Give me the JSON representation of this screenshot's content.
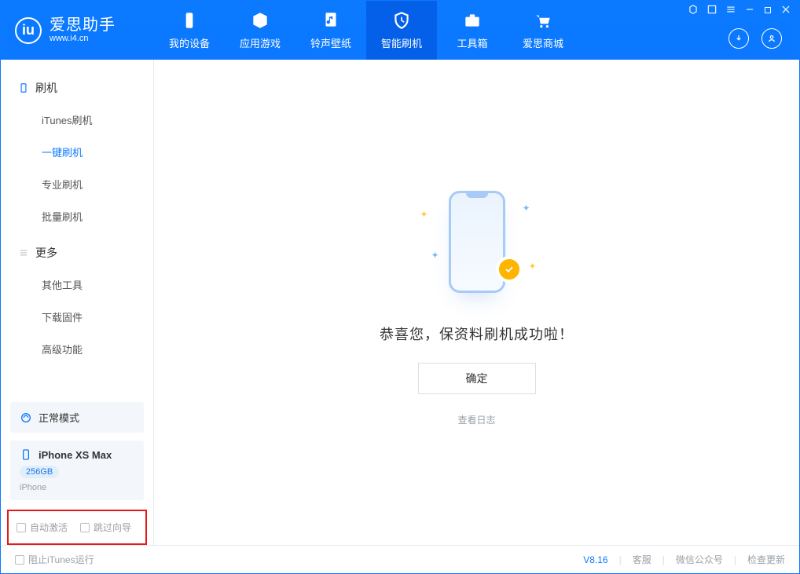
{
  "brand": {
    "name": "爱思助手",
    "url": "www.i4.cn"
  },
  "titlebar_icons": [
    "settings",
    "frame",
    "list",
    "minimize",
    "maximize",
    "close"
  ],
  "nav": {
    "tabs": [
      {
        "label": "我的设备",
        "icon": "device"
      },
      {
        "label": "应用游戏",
        "icon": "cube"
      },
      {
        "label": "铃声壁纸",
        "icon": "music"
      },
      {
        "label": "智能刷机",
        "icon": "shield",
        "active": true
      },
      {
        "label": "工具箱",
        "icon": "toolbox"
      },
      {
        "label": "爱思商城",
        "icon": "cart"
      }
    ]
  },
  "sidebar": {
    "groups": [
      {
        "title": "刷机",
        "icon": "phone",
        "items": [
          {
            "label": "iTunes刷机"
          },
          {
            "label": "一键刷机",
            "active": true
          },
          {
            "label": "专业刷机"
          },
          {
            "label": "批量刷机"
          }
        ]
      },
      {
        "title": "更多",
        "icon": "list",
        "items": [
          {
            "label": "其他工具"
          },
          {
            "label": "下载固件"
          },
          {
            "label": "高级功能"
          }
        ]
      }
    ],
    "mode_panel": {
      "label": "正常模式"
    },
    "device_panel": {
      "name": "iPhone XS Max",
      "capacity": "256GB",
      "type": "iPhone"
    },
    "checkboxes": {
      "auto_activate": "自动激活",
      "skip_guide": "跳过向导"
    }
  },
  "main": {
    "message": "恭喜您，保资料刷机成功啦！",
    "ok_label": "确定",
    "log_link": "查看日志"
  },
  "footer": {
    "block_itunes": "阻止iTunes运行",
    "version": "V8.16",
    "links": [
      "客服",
      "微信公众号",
      "检查更新"
    ]
  }
}
